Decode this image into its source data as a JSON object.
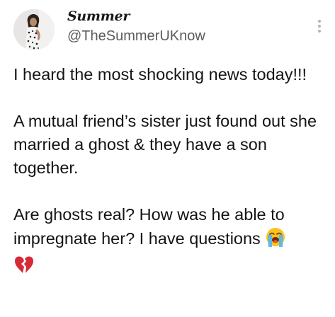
{
  "tweet": {
    "author": {
      "display_name": "Summer",
      "handle": "@TheSummerUKnow",
      "avatar": "profile-photo"
    },
    "more_options_icon": "vertical-ellipsis-icon",
    "paragraphs": [
      "I heard the most shocking news today!!!",
      "A mutual friend’s sister just found out she married a ghost & they have a son together.",
      "Are ghosts real? How was he able to impregnate her? I have questions"
    ],
    "emojis": [
      "loudly-crying-face-icon",
      "broken-heart-icon"
    ],
    "colors": {
      "text": "#141414",
      "handle": "#5b5b5b",
      "broken_heart": "#d62a37"
    }
  }
}
